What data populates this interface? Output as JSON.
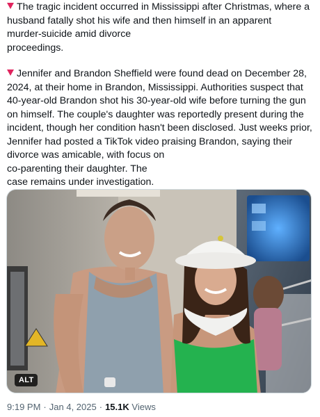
{
  "tweet": {
    "paragraph_1": "The tragic incident occurred in Mississippi after Christmas, where a husband fatally shot his wife and then himself in an apparent\nmurder-suicide amid divorce\nproceedings.",
    "paragraph_2": "Jennifer and Brandon Sheffield were found dead on December 28, 2024, at their home in Brandon, Mississippi. Authorities suspect that 40-year-old Brandon shot his 30-year-old wife before turning the gun on himself. The couple's daughter was reportedly present during the incident, though her condition hasn't been disclosed. Just weeks prior, Jennifer had posted a TikTok video praising Brandon, saying their divorce was amicable, with focus on\nco-parenting their daughter. The\ncase remains under investigation.",
    "bullet_icon": "red-down-triangle-icon",
    "bullet_color": "#e0245e"
  },
  "media": {
    "alt_label": "ALT"
  },
  "meta": {
    "time": "9:19 PM",
    "separator": "·",
    "date": "Jan 4, 2025",
    "views_count": "15.1K",
    "views_label": "Views"
  }
}
